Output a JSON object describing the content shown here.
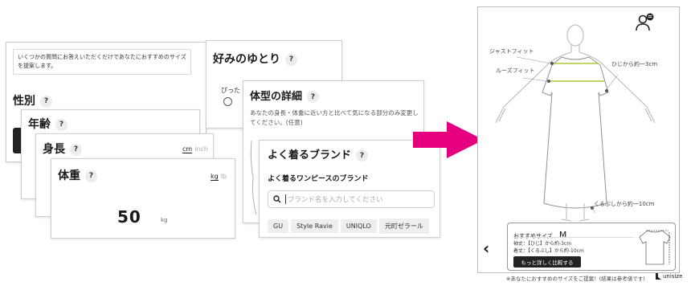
{
  "cards": {
    "intro": {
      "description": "いくつかの質問にお答えいただくだけであなたにおすすめのサイズを提案します。",
      "title": "性別"
    },
    "age": {
      "title": "年齢"
    },
    "height": {
      "title": "身長",
      "unit_on": "cm",
      "unit_off": "inch"
    },
    "weight": {
      "title": "体重",
      "unit_on": "kg",
      "unit_off": "lb",
      "value": "50",
      "value_unit": "kg"
    },
    "fit": {
      "title": "好みのゆとり",
      "option_prefix": "ぴった"
    },
    "body_detail": {
      "title": "体型の詳細",
      "description": "あなたの身長・体重に近い方と比べて気になる部分のみ変更してください。(任意)"
    },
    "brand": {
      "title": "よく着るブランド",
      "subtitle": "よく着るワンピースのブランド",
      "search_placeholder": "ブランド名を入力してください",
      "chips": [
        "GU",
        "Style Ravie",
        "UNIQLO",
        "元町ゼラール"
      ]
    },
    "help_mark": "?"
  },
  "result": {
    "callouts": {
      "just_fit": "ジャストフィット",
      "loose_fit": "ルーズフィット",
      "sleeve": "ひじから約一3cm",
      "hem": "くるぶしから約一10cm"
    },
    "recommend_label": "おすすめサイズ",
    "recommend_size": "M",
    "detail_1": "袖丈：【ひじ】から約-3cm",
    "detail_2": "着丈：【くるぶし】から約-10cm",
    "compare_button": "もっと詳しく比較する",
    "footnote": "※あなたにおすすめのサイズをご提案！(結果は参考値です)",
    "brand_logo": "unisize",
    "back_glyph": "‹"
  },
  "colors": {
    "arrow": "#e6007e",
    "fit_line": "#a8c83c",
    "dark_button": "#222222"
  }
}
